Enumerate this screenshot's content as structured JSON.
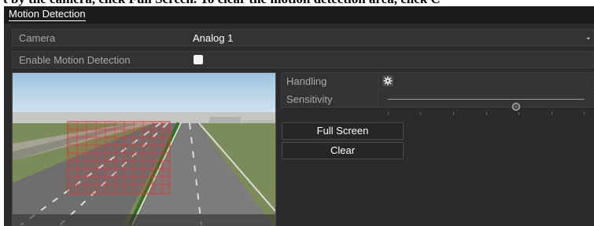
{
  "header": {
    "truncated_text": "t by the camera, click Full Screen. To clear the motion detection area, click C"
  },
  "window": {
    "title": "Motion Detection"
  },
  "camera": {
    "label": "Camera",
    "value": "Analog 1",
    "caret": "⌄"
  },
  "enable_motion": {
    "label": "Enable Motion Detection",
    "checked": false
  },
  "settings": {
    "handling_label": "Handling",
    "sensitivity_label": "Sensitivity",
    "sensitivity_level": 0.65
  },
  "buttons": {
    "full_screen": "Full Screen",
    "clear": "Clear"
  },
  "icons": {
    "handling": "gear-icon",
    "camera_dropdown": "chevron-down-icon"
  },
  "colors": {
    "panel_bg": "#2b2b2b",
    "row_bg": "#333333",
    "label_text": "#a9a9a9",
    "value_text": "#ffffff",
    "motion_grid": "#d23c3c"
  }
}
